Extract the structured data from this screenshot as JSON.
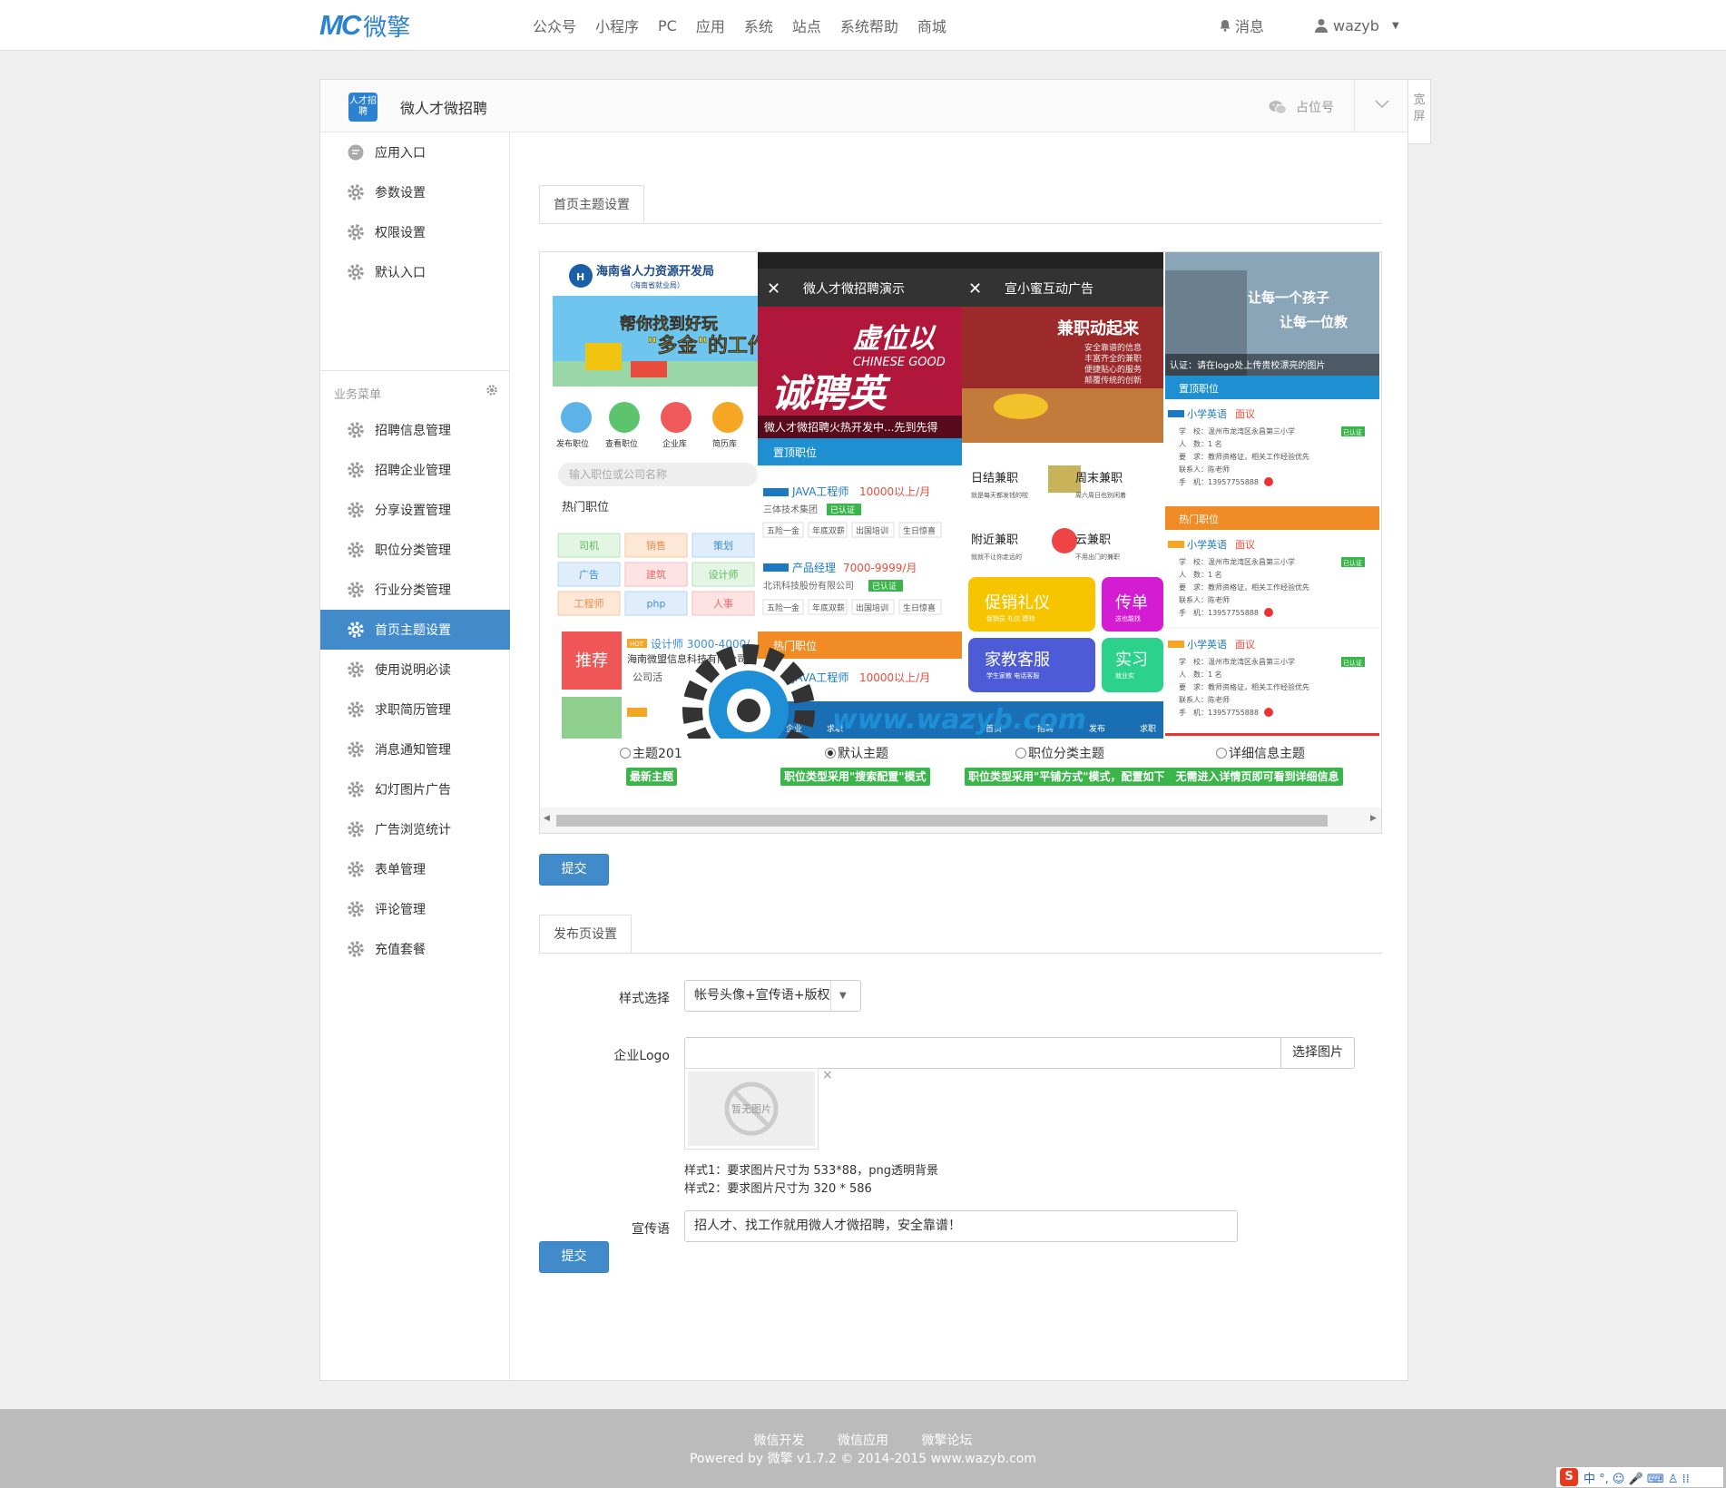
{
  "topbar": {
    "logo_mark": "MC",
    "logo_text": "微擎",
    "nav": [
      "公众号",
      "小程序",
      "PC",
      "应用",
      "系统",
      "站点",
      "系统帮助",
      "商城"
    ],
    "messages": "消息",
    "username": "wazyb"
  },
  "header": {
    "app_icon_text": "人才招聘",
    "app_title": "微人才微招聘",
    "placeholder_account": "占位号",
    "wide_toggle": "宽屏"
  },
  "sidebar": {
    "top_items": [
      "应用入口",
      "参数设置",
      "权限设置",
      "默认入口"
    ],
    "group_title": "业务菜单",
    "items": [
      "招聘信息管理",
      "招聘企业管理",
      "分享设置管理",
      "职位分类管理",
      "行业分类管理",
      "首页主题设置",
      "使用说明必读",
      "求职简历管理",
      "消息通知管理",
      "幻灯图片广告",
      "广告浏览统计",
      "表单管理",
      "评论管理",
      "充值套餐"
    ],
    "active_item": "首页主题设置"
  },
  "theme_section": {
    "tab": "首页主题设置",
    "previews": {
      "p1": {
        "org_title": "海南省人力资源开发局",
        "org_sub": "（海南省就业局）",
        "icons": [
          "发布职位",
          "查看职位",
          "企业库",
          "简历库"
        ],
        "search_placeholder": "输入职位或公司名称",
        "hot_label": "热门职位",
        "job_tags": [
          "司机",
          "销售",
          "策划",
          "广告",
          "建筑",
          "设计师",
          "工程师",
          "php",
          "人事"
        ],
        "recommend": "推荐",
        "hot_job": "设计师 3000-4000/",
        "hot_company": "海南微盟信息科技有限公司",
        "hot_tag": "公司活"
      },
      "p2": {
        "title": "微人才微招聘演示",
        "banner_caption": "微人才微招聘火热开发中...先到先得",
        "banner_big": "诚聘英",
        "banner_top": "虚位以",
        "banner_en": "CHINESE GOOD",
        "section1": "置顶职位",
        "job1_title": "JAVA工程师",
        "job1_salary": "10000以上/月",
        "job1_company": "三体技术集团",
        "verified": "已认证",
        "benefits": [
          "五险一金",
          "年底双薪",
          "出国培训",
          "生日惊喜"
        ],
        "job2_title": "产品经理",
        "job2_salary": "7000-9999/月",
        "job2_company": "北讯科技股份有限公司",
        "section2": "热门职位",
        "job3_title": "JAVA工程师",
        "job3_salary": "10000以上/月",
        "tabbar": [
          "首页",
          "企业",
          "求职",
          "首页",
          "招聘",
          "发布",
          "求职"
        ]
      },
      "p3": {
        "title": "宣小蜜互动广告",
        "banner_title": "兼职动起来",
        "banner_lines": [
          "安全靠谱的信息",
          "丰富齐全的兼职",
          "便捷贴心的服务",
          "颠覆传统的创新"
        ],
        "cards": [
          {
            "title": "日结兼职",
            "sub": "就是每天都发钱的啦"
          },
          {
            "title": "周末兼职",
            "sub": "周六周日也别闲着"
          },
          {
            "title": "附近兼职",
            "sub": "就就不让你走远的"
          },
          {
            "title": "云兼职",
            "sub": "不用出门的兼职"
          }
        ],
        "tiles": [
          {
            "title": "促销礼仪",
            "sub": "促销员 礼仪 模特",
            "color": "#f7c500"
          },
          {
            "title": "传单",
            "sub": "这也能找",
            "color": "#d41cd3"
          },
          {
            "title": "家教客服",
            "sub": "学生家教 电话客服",
            "color": "#4e5bd6"
          },
          {
            "title": "实习",
            "sub": "就业实",
            "color": "#2cd18b"
          }
        ]
      },
      "p4": {
        "banner_line1": "让每一个孩子",
        "banner_line2": "让每一位教",
        "banner_caption": "认证：请在logo处上传贵校漂亮的图片",
        "section1": "置顶职位",
        "section2": "热门职位",
        "job_title": "小学英语",
        "job_flag": "面议",
        "school": "学　校：温州市龙湾区永昌第三小学",
        "count": "人　数：1 名",
        "req": "要　求：教师资格证，相关工作经验优先",
        "contact": "联系人：陈老师",
        "phone": "手　机：13957755888",
        "verified": "已认证"
      }
    },
    "radios": [
      {
        "label": "主题201",
        "checked": false
      },
      {
        "label": "默认主题",
        "checked": true
      },
      {
        "label": "职位分类主题",
        "checked": false
      },
      {
        "label": "详细信息主题",
        "checked": false
      }
    ],
    "tags": [
      "最新主题",
      "职位类型采用\"搜索配置\"模式",
      "职位类型采用\"平铺方式\"模式，配置如下　无需进入详情页即可看到详细信息"
    ],
    "watermark_site": "www.wazyb.com",
    "submit": "提交"
  },
  "publish_section": {
    "tab": "发布页设置",
    "style_label": "样式选择",
    "style_value": "帐号头像+宣传语+版权",
    "logo_label": "企业Logo",
    "logo_value": "",
    "choose_image": "选择图片",
    "no_image": "暂无图片",
    "remove": "×",
    "hint1": "样式1：要求图片尺寸为 533*88，png透明背景",
    "hint2": "样式2：要求图片尺寸为 320 * 586",
    "slogan_label": "宣传语",
    "slogan_value": "招人才、找工作就用微人才微招聘，安全靠谱！",
    "submit": "提交"
  },
  "footer": {
    "links": [
      "微信开发",
      "微信应用",
      "微擎论坛"
    ],
    "copyright": "Powered by 微擎 v1.7.2 © 2014-2015 www.wazyb.com"
  },
  "ime": {
    "logo": "S",
    "text": "中 °, ☺ 🎤 ⌨ ♙ ⁞⁞"
  }
}
